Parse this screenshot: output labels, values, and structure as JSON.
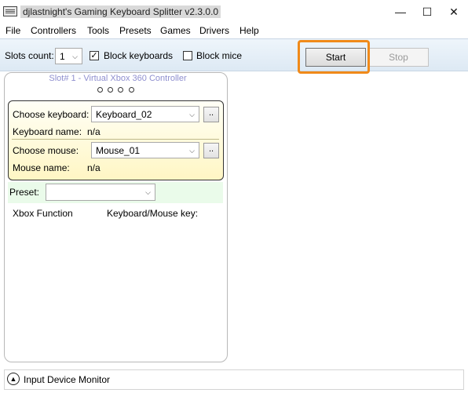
{
  "window": {
    "title": "djlastnight's Gaming Keyboard Splitter v2.3.0.0",
    "minimize_glyph": "—",
    "maximize_glyph": "☐",
    "close_glyph": "✕"
  },
  "menu": {
    "items": [
      "File",
      "Controllers",
      "Tools",
      "Presets",
      "Games",
      "Drivers",
      "Help"
    ]
  },
  "toolbar": {
    "slots_count_label": "Slots count:",
    "slots_count_value": "1",
    "block_keyboards_label": "Block keyboards",
    "block_keyboards_checked": true,
    "block_keyboards_mark": "✓",
    "block_mice_label": "Block mice",
    "block_mice_checked": false,
    "start_label": "Start",
    "stop_label": "Stop",
    "highlight_color": "#f08a1a"
  },
  "slot": {
    "title": "Slot# 1 - Virtual Xbox 360 Controller",
    "indicator_count": 4,
    "keyboard_label": "Choose keyboard:",
    "keyboard_value": "Keyboard_02",
    "keyboard_name_label": "Keyboard name:",
    "keyboard_name_value": "n/a",
    "mouse_label": "Choose mouse:",
    "mouse_value": "Mouse_01",
    "mouse_name_label": "Mouse name:",
    "mouse_name_value": "n/a",
    "browse_label": "..",
    "preset_label": "Preset:",
    "preset_value": "",
    "col_function": "Xbox Function",
    "col_key": "Keyboard/Mouse key:"
  },
  "monitor": {
    "label": "Input Device Monitor",
    "icon": "chevron-up-icon"
  },
  "colors": {
    "slot_title": "#8f8fcf",
    "device_box_top": "#fffff6",
    "device_box_bottom": "#fff6c4",
    "preset_strip": "#eafbea"
  }
}
